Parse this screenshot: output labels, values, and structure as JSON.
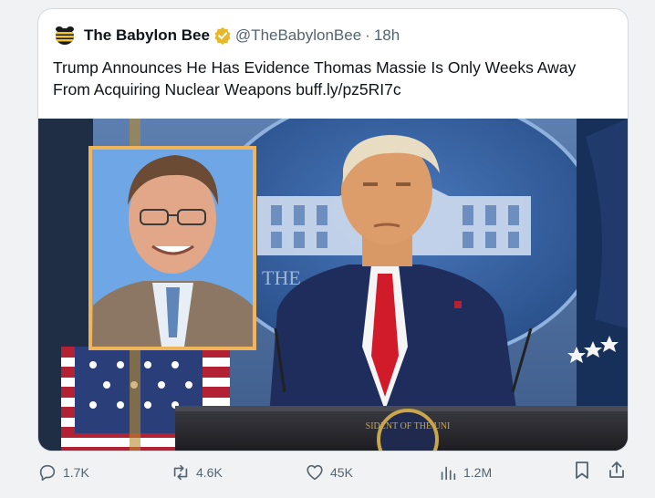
{
  "tweet": {
    "author_name": "The Babylon Bee",
    "handle": "@TheBabylonBee",
    "separator": "·",
    "time": "18h",
    "text": "Trump Announces He Has Evidence Thomas Massie Is Only Weeks Away From Acquiring Nuclear Weapons",
    "link": "buff.ly/pz5RI7c",
    "verified_color": "#e8b829",
    "logo_icon": "babylon-bee-logo-icon"
  },
  "media": {
    "image_description_icon": "press-briefing-photo",
    "seal_text": "SIDENT OF THE UNI",
    "backdrop_text": "THE"
  },
  "actions": {
    "replies": "1.7K",
    "reposts": "4.6K",
    "likes": "45K",
    "views": "1.2M"
  },
  "colors": {
    "text": "#0f1419",
    "muted": "#536471",
    "accent": "#1d9bf0"
  }
}
